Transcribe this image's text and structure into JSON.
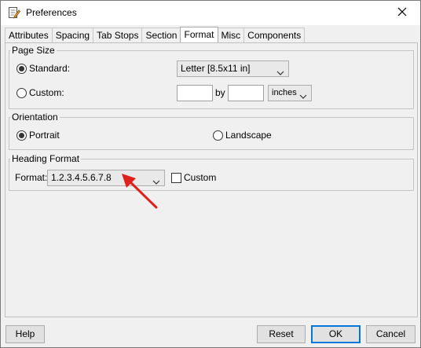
{
  "window": {
    "title": "Preferences",
    "app_icon": "document-edit-icon",
    "close_icon": "close-icon"
  },
  "tabs": [
    {
      "label": "Attributes"
    },
    {
      "label": "Spacing"
    },
    {
      "label": "Tab Stops"
    },
    {
      "label": "Section"
    },
    {
      "label": "Format",
      "active": true
    },
    {
      "label": "Misc"
    },
    {
      "label": "Components"
    }
  ],
  "page_size": {
    "title": "Page Size",
    "standard_label": "Standard:",
    "standard_selected": true,
    "standard_value": "Letter [8.5x11 in]",
    "custom_label": "Custom:",
    "custom_selected": false,
    "width_value": "",
    "by_label": "by",
    "height_value": "",
    "unit_value": "inches"
  },
  "orientation": {
    "title": "Orientation",
    "portrait_label": "Portrait",
    "portrait_selected": true,
    "landscape_label": "Landscape",
    "landscape_selected": false
  },
  "heading_format": {
    "title": "Heading Format",
    "format_label": "Format:",
    "format_value": "1.2.3.4.5.6.7.8",
    "custom_label": "Custom",
    "custom_checked": false
  },
  "annotation": {
    "arrow_color": "#e0201b",
    "arrow_icon": "red-arrow-icon"
  },
  "buttons": {
    "help": "Help",
    "reset": "Reset",
    "ok": "OK",
    "cancel": "Cancel"
  },
  "colors": {
    "default_button_border": "#0078d7"
  }
}
